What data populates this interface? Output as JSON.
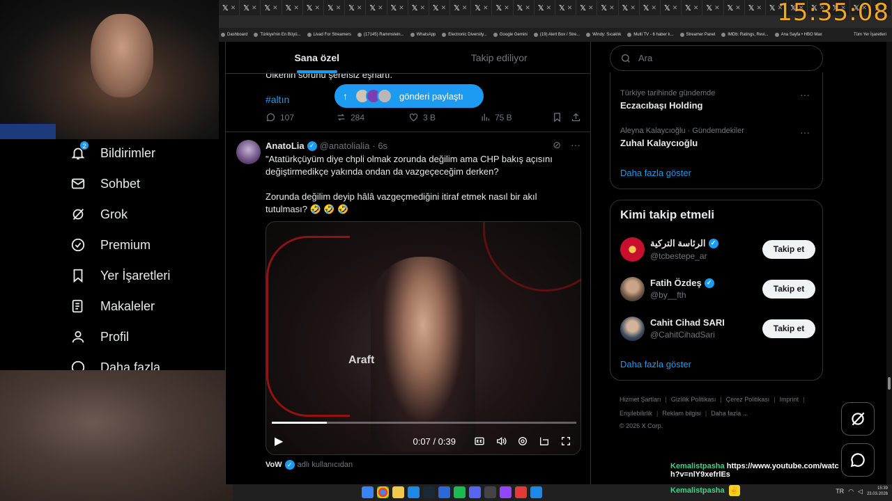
{
  "overlay_clock": "15:35:08",
  "browser": {
    "tab_count": 32,
    "tab_glyph": "𝕏",
    "tab_close": "✕",
    "bookmarks": [
      "Dashboard",
      "Türkiye'nin En Büyü...",
      "Livad For Streamers",
      "(17145) Rammstein...",
      "WhatsApp",
      "Electronic Diversity...",
      "Google Gemini",
      "(19) Alert Box / Stre...",
      "Windy: Sıcaklık",
      "Multi TV - 6 haber k...",
      "Streamer Panel",
      "IMDb: Ratings, Revi...",
      "Ana Sayfa • HBO Max"
    ],
    "bookmarks_all": "Tüm Yer İşaretleri"
  },
  "nav": {
    "items": [
      {
        "label": "Bildirimler",
        "icon": "bell-icon",
        "badge": "2"
      },
      {
        "label": "Sohbet",
        "icon": "mail-icon"
      },
      {
        "label": "Grok",
        "icon": "grok-icon"
      },
      {
        "label": "Premium",
        "icon": "verified-badge-icon"
      },
      {
        "label": "Yer İşaretleri",
        "icon": "bookmark-icon"
      },
      {
        "label": "Makaleler",
        "icon": "article-icon"
      },
      {
        "label": "Profil",
        "icon": "person-icon"
      },
      {
        "label": "Daha fazla",
        "icon": "more-circle-icon"
      }
    ]
  },
  "feed": {
    "tabs": [
      "Sana özel",
      "Takip ediliyor"
    ],
    "active_tab": 0,
    "prev_post": {
      "text_fragment": "Ülkenin sorunu şerefsiz eşhartı.",
      "hashtag": "#altın",
      "replies": "107",
      "reposts": "284",
      "likes": "3 B",
      "views": "75 B"
    },
    "share_pill": {
      "label": "gönderi paylaştı",
      "arrow": "↑"
    },
    "tweet": {
      "name": "AnatoLia",
      "handle": "@anatolialia",
      "time": "· 6s",
      "body": "\"Atatürkçüyüm diye chpli olmak zorunda değilim ama CHP bakış açısını değiştirmedikçe yakında ondan da vazgeçeceğim derken?\n\nZorunda değilim deyip hâlâ vazgeçmediğini itiraf etmek nasıl bir akıl tutulması? 🤣 🤣 🤣",
      "video": {
        "watermark": "Araft",
        "time": "0:07 / 0:39",
        "progress": 0.18
      }
    },
    "next": {
      "name": "VoW",
      "subtitle": "adlı kullanıcıdan"
    }
  },
  "right": {
    "search_placeholder": "Ara",
    "trends": [
      {
        "meta": "Türkiye tarihinde gündemde",
        "title": "Eczacıbaşı Holding"
      },
      {
        "meta": "Aleyna Kalaycıoğlu · Gündemdekiler",
        "title": "Zuhal Kalaycıoğlu"
      }
    ],
    "show_more": "Daha fazla göster",
    "who_to_follow": {
      "title": "Kimi takip etmeli",
      "button": "Takip et",
      "accounts": [
        {
          "name": "الرئاسة التركية",
          "handle": "@tcbestepe_ar",
          "color": "#c8102e"
        },
        {
          "name": "Fatih Özdeş",
          "handle": "@by__fth",
          "color": "#8a7a6a"
        },
        {
          "name": "Cahit Cihad SARI",
          "handle": "@CahitCihadSari",
          "color": "#4a5a70"
        }
      ],
      "show_more": "Daha fazla göster"
    },
    "footer": [
      "Hizmet Şartları",
      "Gizlilik Politikası",
      "Çerez Politikası",
      "Imprint",
      "Erişilebilirlik",
      "Reklam bilgisi",
      "Daha fazla ...",
      "© 2026 X Corp."
    ]
  },
  "chat": {
    "user1": "Kemalistpasha",
    "msg1": "https://www.youtube.com/watch?v=nlY9xefrlEs",
    "user2": "Kemalistpasha"
  },
  "taskbar": {
    "time": "15:39",
    "date": "23.03.2026",
    "lang": "TR"
  }
}
